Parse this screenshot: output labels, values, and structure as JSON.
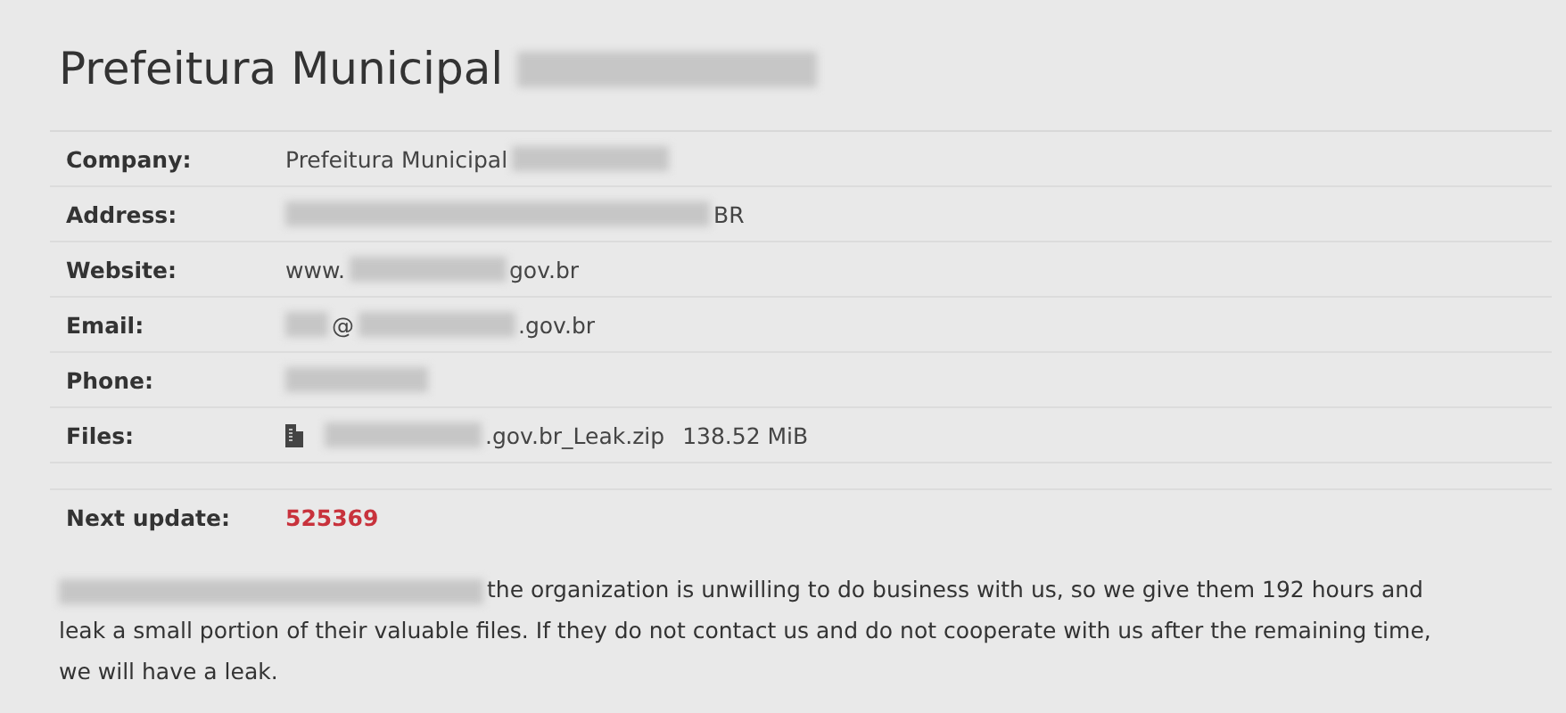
{
  "title": [
    {
      "kind": "text",
      "text": "Prefeitura Municipal"
    },
    {
      "kind": "blurlong"
    }
  ],
  "fields": [
    {
      "label": "Company:",
      "kind": "plain",
      "value": [
        {
          "kind": "text",
          "text": "Prefeitura Municipal"
        },
        {
          "kind": "blurmedium"
        }
      ]
    },
    {
      "label": "Address:",
      "kind": "plain",
      "value": [
        {
          "kind": "blurxlong"
        },
        {
          "kind": "text",
          "text": "BR"
        }
      ]
    },
    {
      "label": "Website:",
      "kind": "plain",
      "value": [
        {
          "kind": "text",
          "text": "www."
        },
        {
          "kind": "blurmedium"
        },
        {
          "kind": "text",
          "text": "gov.br"
        }
      ]
    },
    {
      "label": "Email:",
      "kind": "plain",
      "value": [
        {
          "kind": "blurtiny"
        },
        {
          "kind": "text",
          "text": "@"
        },
        {
          "kind": "blurmedium"
        },
        {
          "kind": "text",
          "text": ".gov.br"
        }
      ]
    },
    {
      "label": "Phone:",
      "kind": "plain",
      "value": [
        {
          "kind": "blurshort"
        }
      ]
    },
    {
      "label": "Files:",
      "kind": "file",
      "value": [
        {
          "kind": "blurmedium"
        },
        {
          "kind": "text",
          "text": ".gov.br_Leak.zip"
        }
      ],
      "size": "138.52 MiB"
    },
    {
      "label": "Next update:",
      "kind": "countdown",
      "value": [
        {
          "kind": "text",
          "text": "525369"
        }
      ]
    }
  ],
  "message": [
    {
      "kind": "blurxlong"
    },
    {
      "kind": "text",
      "text": "the organization is unwilling to do business with us, so we give them 192 hours and leak a small portion of their valuable files. If they do not contact us and do not cooperate with us after the remaining time, we will have a leak."
    }
  ]
}
